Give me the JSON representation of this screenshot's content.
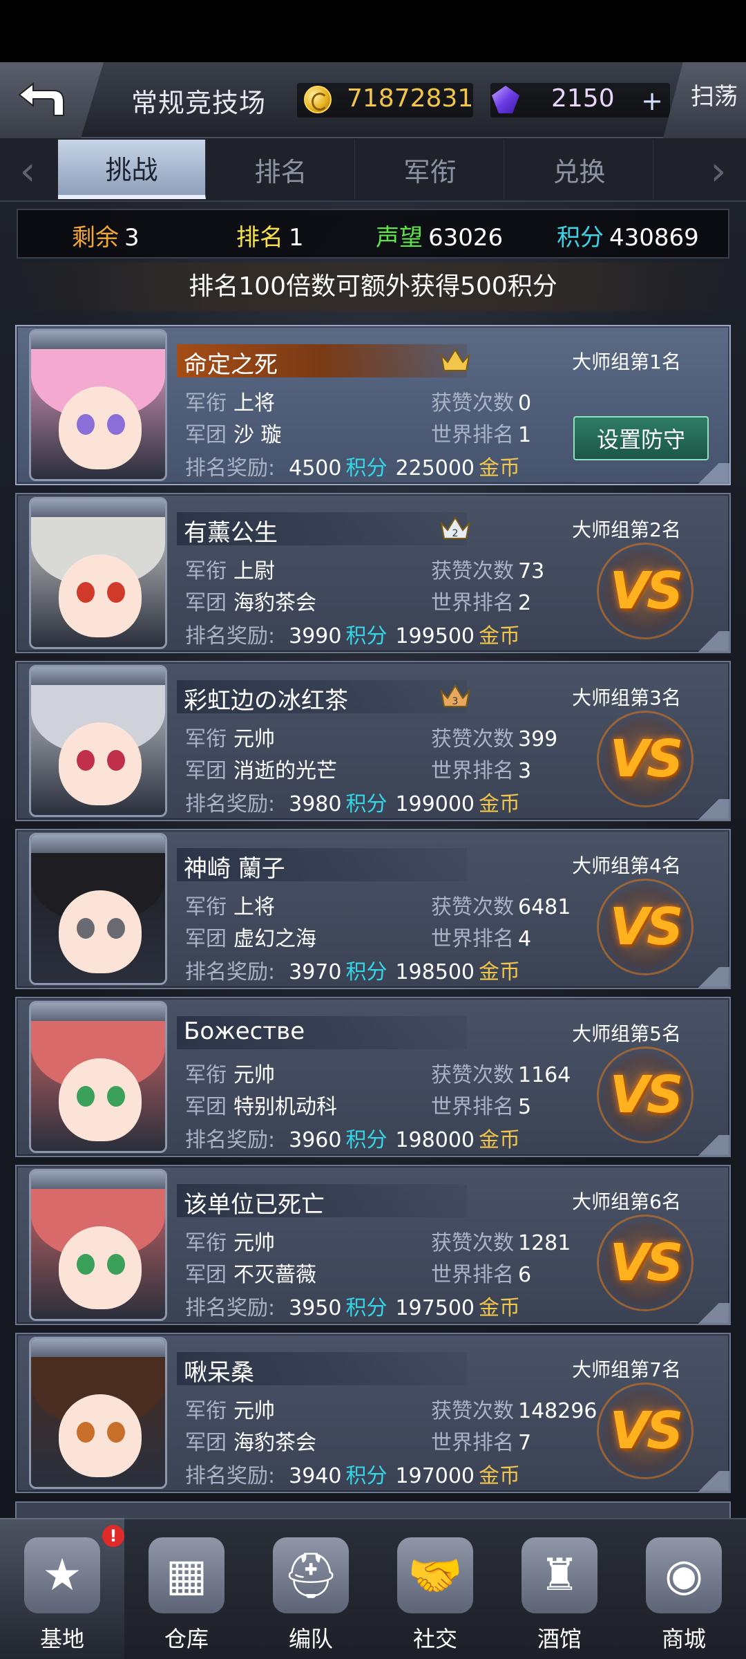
{
  "header": {
    "title": "常规竞技场",
    "gold": "71872831",
    "gems": "2150",
    "plus_label": "+",
    "sweep_label": "扫荡"
  },
  "tabs": [
    {
      "label": "挑战",
      "active": true
    },
    {
      "label": "排名",
      "active": false
    },
    {
      "label": "军衔",
      "active": false
    },
    {
      "label": "兑换",
      "active": false
    }
  ],
  "stats": {
    "remaining_label": "剩余",
    "remaining_value": "3",
    "rank_label": "排名",
    "rank_value": "1",
    "fame_label": "声望",
    "fame_value": "63026",
    "score_label": "积分",
    "score_value": "430869"
  },
  "notice": "排名100倍数可额外获得500积分",
  "labels": {
    "title_key": "军衔",
    "guild_key": "军团",
    "likes_key": "获赞次数",
    "world_rank_key": "世界排名",
    "reward_key": "排名奖励:",
    "points_unit": "积分",
    "gold_unit": "金币",
    "vs": "VS",
    "defend_button": "设置防守"
  },
  "players": [
    {
      "name": "命定之死",
      "group": "大师组第1名",
      "title": "上将",
      "guild": "沙 璇",
      "likes": "0",
      "world_rank": "1",
      "reward_points": "4500",
      "reward_gold": "225000",
      "self": true,
      "crown_color": "#f2c64a",
      "crown_num": "",
      "hair": "#f4a9d0",
      "eyes": "#8a6fd8"
    },
    {
      "name": "有薰公生",
      "group": "大师组第2名",
      "title": "上尉",
      "guild": "海豹茶会",
      "likes": "73",
      "world_rank": "2",
      "reward_points": "3990",
      "reward_gold": "199500",
      "self": false,
      "crown_color": "#e6ecf4",
      "crown_num": "2",
      "hair": "#d9d9d6",
      "eyes": "#d03a2a"
    },
    {
      "name": "彩虹边の冰红茶",
      "group": "大师组第3名",
      "title": "元帅",
      "guild": "消逝的光芒",
      "likes": "399",
      "world_rank": "3",
      "reward_points": "3980",
      "reward_gold": "199000",
      "self": false,
      "crown_color": "#e8a860",
      "crown_num": "3",
      "hair": "#cfd2d8",
      "eyes": "#c0304a"
    },
    {
      "name": "神崎 蘭子",
      "group": "大师组第4名",
      "title": "上将",
      "guild": "虚幻之海",
      "likes": "6481",
      "world_rank": "4",
      "reward_points": "3970",
      "reward_gold": "198500",
      "self": false,
      "crown_color": "",
      "crown_num": "",
      "hair": "#1d1d22",
      "eyes": "#6a6a72"
    },
    {
      "name": "Божестве",
      "group": "大师组第5名",
      "title": "元帅",
      "guild": "特别机动科",
      "likes": "1164",
      "world_rank": "5",
      "reward_points": "3960",
      "reward_gold": "198000",
      "self": false,
      "crown_color": "",
      "crown_num": "",
      "hair": "#d86a6a",
      "eyes": "#3aa05a"
    },
    {
      "name": "该单位已死亡",
      "group": "大师组第6名",
      "title": "元帅",
      "guild": "不灭蔷薇",
      "likes": "1281",
      "world_rank": "6",
      "reward_points": "3950",
      "reward_gold": "197500",
      "self": false,
      "crown_color": "",
      "crown_num": "",
      "hair": "#d86a6a",
      "eyes": "#3aa05a"
    },
    {
      "name": "啾呆桑",
      "group": "大师组第7名",
      "title": "元帅",
      "guild": "海豹茶会",
      "likes": "148296",
      "world_rank": "7",
      "reward_points": "3940",
      "reward_gold": "197000",
      "self": false,
      "crown_color": "",
      "crown_num": "",
      "hair": "#4a2e22",
      "eyes": "#c8702a"
    }
  ],
  "nav": [
    {
      "label": "基地",
      "icon": "base-star-icon",
      "active": true,
      "badge": "!"
    },
    {
      "label": "仓库",
      "icon": "warehouse-icon",
      "active": false
    },
    {
      "label": "编队",
      "icon": "formation-helmet-icon",
      "active": false
    },
    {
      "label": "社交",
      "icon": "handshake-icon",
      "active": false
    },
    {
      "label": "酒馆",
      "icon": "tavern-icon",
      "active": false
    },
    {
      "label": "商城",
      "icon": "shop-icon",
      "active": false
    }
  ]
}
